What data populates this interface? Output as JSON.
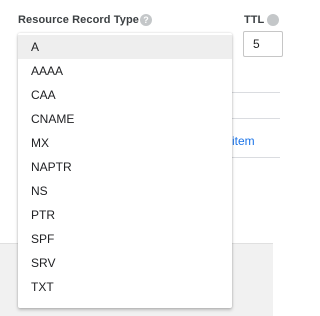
{
  "form": {
    "record_type_label": "Resource Record Type",
    "ttl_label": "TTL",
    "ttl_value": "5",
    "add_item_link": "item"
  },
  "dropdown": {
    "selected": "A",
    "options": [
      {
        "label": "A"
      },
      {
        "label": "AAAA"
      },
      {
        "label": "CAA"
      },
      {
        "label": "CNAME"
      },
      {
        "label": "MX"
      },
      {
        "label": "NAPTR"
      },
      {
        "label": "NS"
      },
      {
        "label": "PTR"
      },
      {
        "label": "SPF"
      },
      {
        "label": "SRV"
      },
      {
        "label": "TXT"
      }
    ]
  },
  "colors": {
    "accent": "#1a73e8",
    "selected_row": "#eeeeee",
    "footer_band": "#f1f1f1",
    "help_icon": "#c4c7c9"
  },
  "icons": {
    "help": "help-circle-icon"
  }
}
